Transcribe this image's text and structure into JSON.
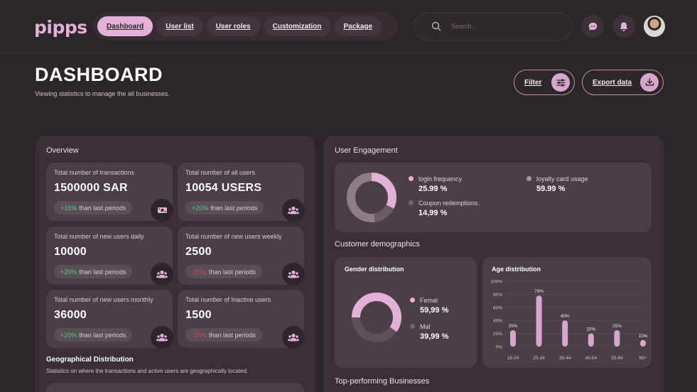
{
  "brand": {
    "logo": "pipps"
  },
  "nav": {
    "tabs": [
      {
        "label": "Dashboard"
      },
      {
        "label": "User list"
      },
      {
        "label": "User roles"
      },
      {
        "label": "Customization"
      },
      {
        "label": "Package"
      }
    ]
  },
  "search": {
    "placeholder": "Search.."
  },
  "page": {
    "title": "DASHBOARD",
    "subtitle": "Viewing statistics to manage the all businesses."
  },
  "actions": {
    "filter_label": "Filter",
    "export_label": "Export data"
  },
  "overview": {
    "title": "Overview",
    "cards": [
      {
        "label": "Total number of transactions",
        "value": "1500000 SAR",
        "change": "+15%",
        "suffix": "than last periods"
      },
      {
        "label": "Total number of all users",
        "value": "10054 USERS",
        "change": "+20%",
        "suffix": "than last periods"
      },
      {
        "label": "Total number of new users daily",
        "value": "10000",
        "change": "+20%",
        "suffix": "than last periods"
      },
      {
        "label": "Total number of new users weekly",
        "value": "2500",
        "change": "-30%",
        "suffix": "than last periods"
      },
      {
        "label": "Total number of new users monthly",
        "value": "36000",
        "change": "+20%",
        "suffix": "than last periods"
      },
      {
        "label": "Total number of Inactive users",
        "value": "1500",
        "change": "-35%",
        "suffix": "than last periods"
      }
    ]
  },
  "geo": {
    "title": "Geographical Distribution",
    "subtitle": "Statistics on where the transactions and active users are geographically located."
  },
  "engagement": {
    "title": "User Engagement",
    "items": [
      {
        "label": "login frequency",
        "value": "25.99 %"
      },
      {
        "label": "Coupon redemptions.",
        "value": "14,99 %"
      },
      {
        "label": "loyalty card usage",
        "value": "59.99 %"
      }
    ]
  },
  "demographics": {
    "title": "Customer demographics",
    "gender": {
      "title": "Gender distribution",
      "items": [
        {
          "label": "Femal",
          "value": "59,99 %"
        },
        {
          "label": "Mal",
          "value": "39,99 %"
        }
      ]
    },
    "age_title": "Age distribution"
  },
  "top_businesses": {
    "title": "Top-performing Businesses"
  },
  "colors": {
    "accent": "#e3b1d8",
    "positive": "#49d27a",
    "negative": "#d9454f",
    "background": "#2c2529"
  },
  "chart_data": {
    "type": "bar",
    "title": "Age distribution",
    "categories": [
      "18-24",
      "25-34",
      "35-44",
      "45-54",
      "55-64",
      "65+"
    ],
    "values": [
      25,
      78,
      40,
      20,
      25,
      10
    ],
    "labels": [
      "25%",
      "78%",
      "40%",
      "20%",
      "25%",
      "10%"
    ],
    "ylim": [
      0,
      100
    ],
    "yticks": [
      "0%",
      "20%",
      "40%",
      "60%",
      "80%",
      "100%"
    ],
    "grid": true,
    "bar_color": "#d6a6cc"
  }
}
